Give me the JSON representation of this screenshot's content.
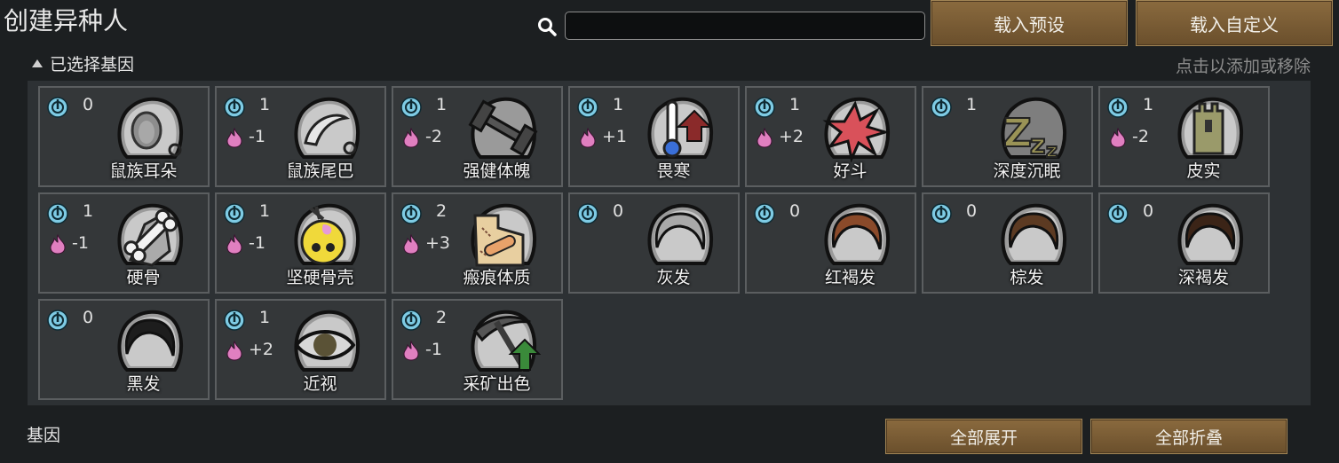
{
  "window": {
    "title": "创建异种人"
  },
  "search": {
    "placeholder": "",
    "value": ""
  },
  "buttons": {
    "load_preset": "载入预设",
    "load_custom": "载入自定义",
    "expand_all": "全部展开",
    "collapse_all": "全部折叠"
  },
  "selected_section": {
    "label": "已选择基因",
    "hint": "点击以添加或移除"
  },
  "footer": {
    "label": "基因"
  },
  "colors": {
    "complexity_icon": "#7ecbe4",
    "metabolism_icon": "#e07fc0",
    "button_brown": "#7a5c34",
    "panel_bg": "#2d3134"
  },
  "genes": [
    {
      "name": "鼠族耳朵",
      "complexity": "0",
      "metabolism": "",
      "icon": "ear-icon"
    },
    {
      "name": "鼠族尾巴",
      "complexity": "1",
      "metabolism": "-1",
      "icon": "tail-icon"
    },
    {
      "name": "强健体魄",
      "complexity": "1",
      "metabolism": "-2",
      "icon": "dumbbell-icon"
    },
    {
      "name": "畏寒",
      "complexity": "1",
      "metabolism": "+1",
      "icon": "thermometer-icon"
    },
    {
      "name": "好斗",
      "complexity": "1",
      "metabolism": "+2",
      "icon": "burst-icon"
    },
    {
      "name": "深度沉眠",
      "complexity": "1",
      "metabolism": "",
      "icon": "sleep-icon"
    },
    {
      "name": "皮实",
      "complexity": "1",
      "metabolism": "-2",
      "icon": "tower-icon"
    },
    {
      "name": "硬骨",
      "complexity": "1",
      "metabolism": "-1",
      "icon": "bone-icon"
    },
    {
      "name": "坚硬骨壳",
      "complexity": "1",
      "metabolism": "-1",
      "icon": "skull-icon"
    },
    {
      "name": "瘢痕体质",
      "complexity": "2",
      "metabolism": "+3",
      "icon": "scar-icon"
    },
    {
      "name": "灰发",
      "complexity": "0",
      "metabolism": "",
      "icon": "hair-icon",
      "hair_color": "#a9a9a9"
    },
    {
      "name": "红褐发",
      "complexity": "0",
      "metabolism": "",
      "icon": "hair-icon",
      "hair_color": "#8a4a2a"
    },
    {
      "name": "棕发",
      "complexity": "0",
      "metabolism": "",
      "icon": "hair-icon",
      "hair_color": "#5c3a22"
    },
    {
      "name": "深褐发",
      "complexity": "0",
      "metabolism": "",
      "icon": "hair-icon",
      "hair_color": "#3b2417"
    },
    {
      "name": "黑发",
      "complexity": "0",
      "metabolism": "",
      "icon": "hair-icon",
      "hair_color": "#1d1d1d"
    },
    {
      "name": "近视",
      "complexity": "1",
      "metabolism": "+2",
      "icon": "eye-icon"
    },
    {
      "name": "采矿出色",
      "complexity": "2",
      "metabolism": "-1",
      "icon": "pickaxe-icon"
    }
  ]
}
